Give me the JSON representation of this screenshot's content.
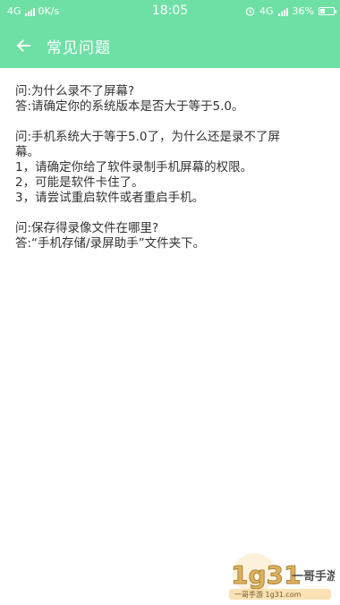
{
  "status_bar": {
    "network_left": "4G",
    "speed": "0K/s",
    "time": "18:05",
    "network_right": "4G",
    "battery_percent": "36%",
    "battery_level": 0.36,
    "alarm_icon": "alarm-clock-icon"
  },
  "toolbar": {
    "back_icon": "back-arrow-icon",
    "title": "常见问题",
    "background": "#6ee0a6"
  },
  "faq": [
    {
      "lines": [
        "问:为什么录不了屏幕?",
        "答:请确定你的系统版本是否大于等于5.0。"
      ]
    },
    {
      "lines": [
        "问:手机系统大于等于5.0了，为什么还是录不了屏",
        "幕。",
        "1，请确定你给了软件录制手机屏幕的权限。",
        "2，可能是软件卡住了。",
        "3，请尝试重启软件或者重启手机。"
      ]
    },
    {
      "lines": [
        "问:保存得录像文件在哪里?",
        "答:“手机存储/录屏助手”文件夹下。"
      ]
    }
  ],
  "watermark": {
    "logo_number": "1g31",
    "logo_text": "一哥手游",
    "url_text": "一哥手游 1g31.com"
  }
}
